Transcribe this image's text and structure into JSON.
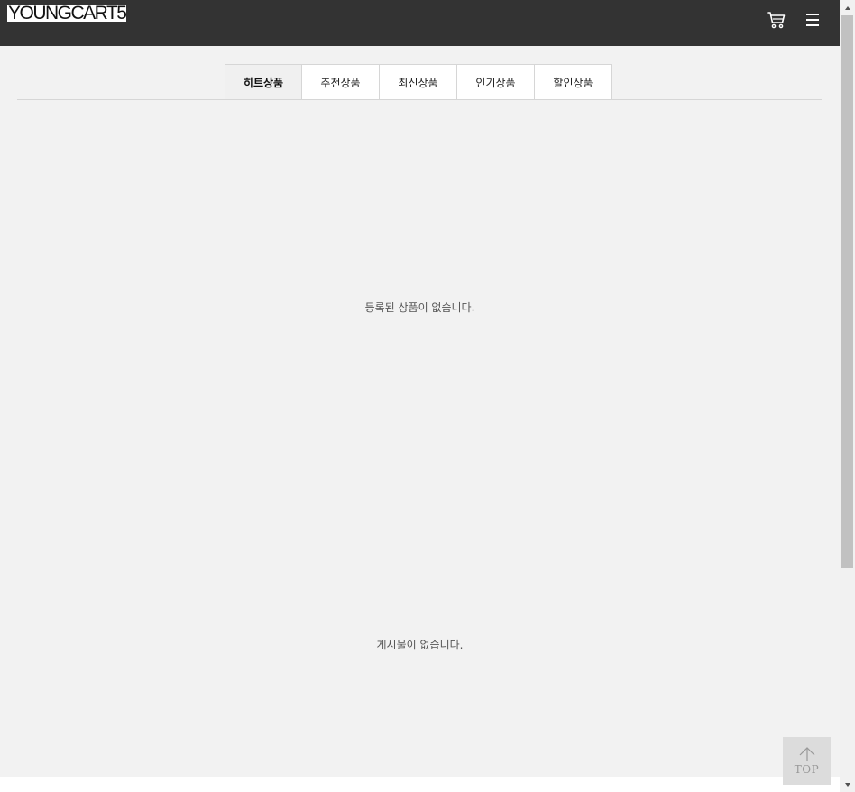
{
  "header": {
    "logo_text": "YOUNGCART5",
    "cart_icon": "cart-icon",
    "menu_icon": "hamburger-menu-icon",
    "bg_color": "#333333"
  },
  "tabs": [
    {
      "label": "히트상품",
      "active": true
    },
    {
      "label": "추천상품",
      "active": false
    },
    {
      "label": "최신상품",
      "active": false
    },
    {
      "label": "인기상품",
      "active": false
    },
    {
      "label": "할인상품",
      "active": false
    }
  ],
  "products": {
    "empty_message": "등록된 상품이 없습니다."
  },
  "posts": {
    "empty_message": "게시물이 없습니다."
  },
  "top_button": {
    "label": "TOP",
    "icon": "arrow-up-icon"
  }
}
